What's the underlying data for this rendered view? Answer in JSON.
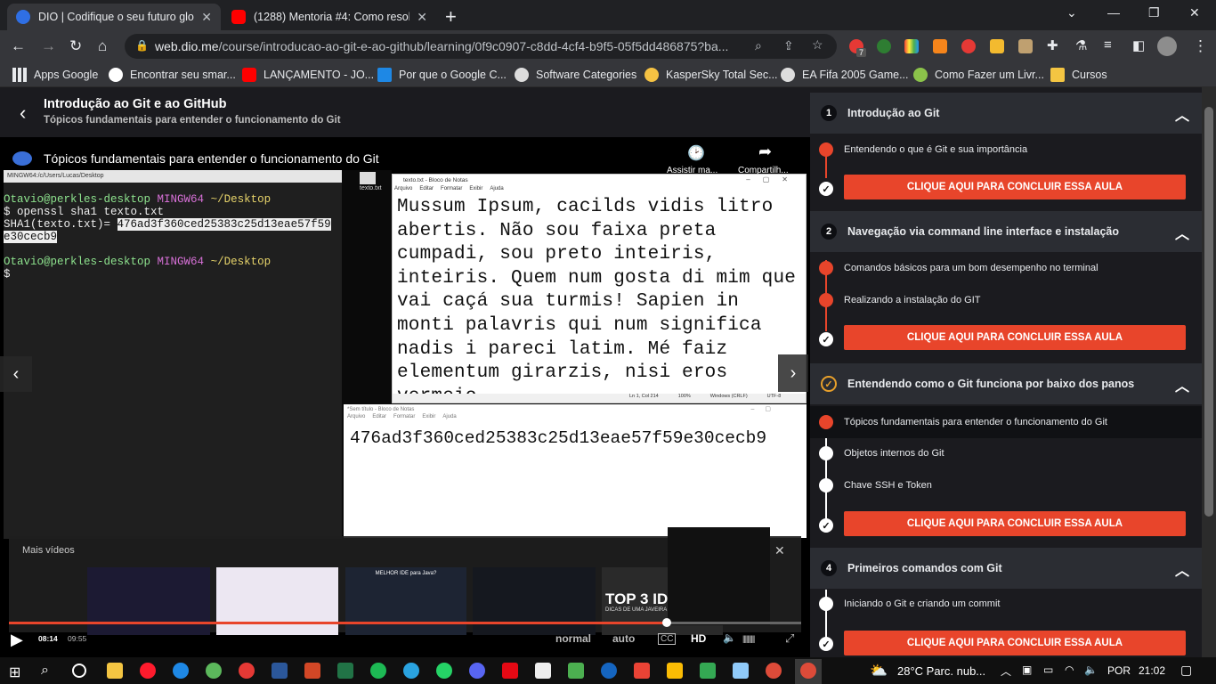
{
  "browser": {
    "tabs": [
      {
        "title": "DIO | Codifique o seu futuro glob",
        "fav": "#2f6fe4"
      },
      {
        "title": "(1288) Mentoria #4: Como resolv",
        "fav": "#ff0000"
      }
    ],
    "url_host": "web.dio.me",
    "url_path": "/course/introducao-ao-git-e-ao-github/learning/0f9c0907-c8dd-4cf4-b9f5-05f5dd486875?ba...",
    "ext_badge": "7",
    "bookmarks": [
      "Apps Google",
      "Encontrar seu smar...",
      "LANÇAMENTO - JO...",
      "Por que o Google C...",
      "Software Categories",
      "KasperSky Total Sec...",
      "EA Fifa 2005 Game...",
      "Como Fazer um Livr...",
      "Cursos"
    ]
  },
  "course": {
    "title": "Introdução ao Git e ao GitHub",
    "subtitle": "Tópicos fundamentais para entender o funcionamento do Git"
  },
  "video": {
    "title": "Tópicos fundamentais para entender o funcionamento do Git",
    "watch_later": "Assistir ma...",
    "share": "Compartilh...",
    "terminal_title": "MINGW64:/c/Users/Lucas/Desktop",
    "terminal": {
      "user": "Otavio@perkles-desktop",
      "env": "MINGW64",
      "path": "~/Desktop",
      "cmd": "$ openssl sha1 texto.txt",
      "out_label": "SHA1(texto.txt)= ",
      "hash1": "476ad3f360ced25383c25d13eae57f59",
      "hash2": "e30cecb9",
      "prompt": "$"
    },
    "desktop_icon": "texto.txt",
    "notepad1": {
      "title": "texto.txt - Bloco de Notas",
      "menu": [
        "Arquivo",
        "Editar",
        "Formatar",
        "Exibir",
        "Ajuda"
      ],
      "text": "Mussum Ipsum, cacilds vidis litro abertis. Não sou faixa preta cumpadi, sou preto inteiris, inteiris. Quem num gosta di mim que vai caçá sua turmis! Sapien in monti palavris qui num significa nadis i pareci latim. Mé faiz elementum girarzis, nisi eros vermeio.",
      "status": [
        "Ln 1, Col 214",
        "100%",
        "Windows (CRLF)",
        "UTF-8"
      ]
    },
    "notepad2": {
      "title": "*Sem título - Bloco de Notas",
      "menu": [
        "Arquivo",
        "Editar",
        "Formatar",
        "Exibir",
        "Ajuda"
      ],
      "text": "476ad3f360ced25383c25d13eae57f59e30cecb9"
    },
    "more_videos": "Mais vídeos",
    "time_current": "08:14",
    "time_total": "09:55",
    "progress": 0.83,
    "ctrl": [
      "normal",
      "auto",
      "HD"
    ],
    "thumb_top3": "TOP 3 IDE",
    "thumb_top3_sub": "DICAS DE UMA JAVEIRA",
    "thumb_java": "MELHOR IDE para Java?"
  },
  "sidebar": {
    "cta": "CLIQUE AQUI PARA CONCLUIR ESSA AULA",
    "sections": [
      {
        "num": "1",
        "title": "Introdução ao Git",
        "lessons": [
          "Entendendo o que é Git e sua importância"
        ]
      },
      {
        "num": "2",
        "title": "Navegação via command line interface e instalação",
        "lessons": [
          "Comandos básicos para um bom desempenho no terminal",
          "Realizando a instalação do GIT"
        ]
      },
      {
        "num": "",
        "title": "Entendendo como o Git funciona por baixo dos panos",
        "lessons": [
          "Tópicos fundamentais para entender o funcionamento do Git",
          "Objetos internos do Git",
          "Chave SSH e Token"
        ]
      },
      {
        "num": "4",
        "title": "Primeiros comandos com Git",
        "lessons": [
          "Iniciando o Git e criando um commit"
        ]
      }
    ]
  },
  "taskbar": {
    "weather": "28°C  Parc. nub...",
    "lang": "POR",
    "time": "21:02"
  }
}
